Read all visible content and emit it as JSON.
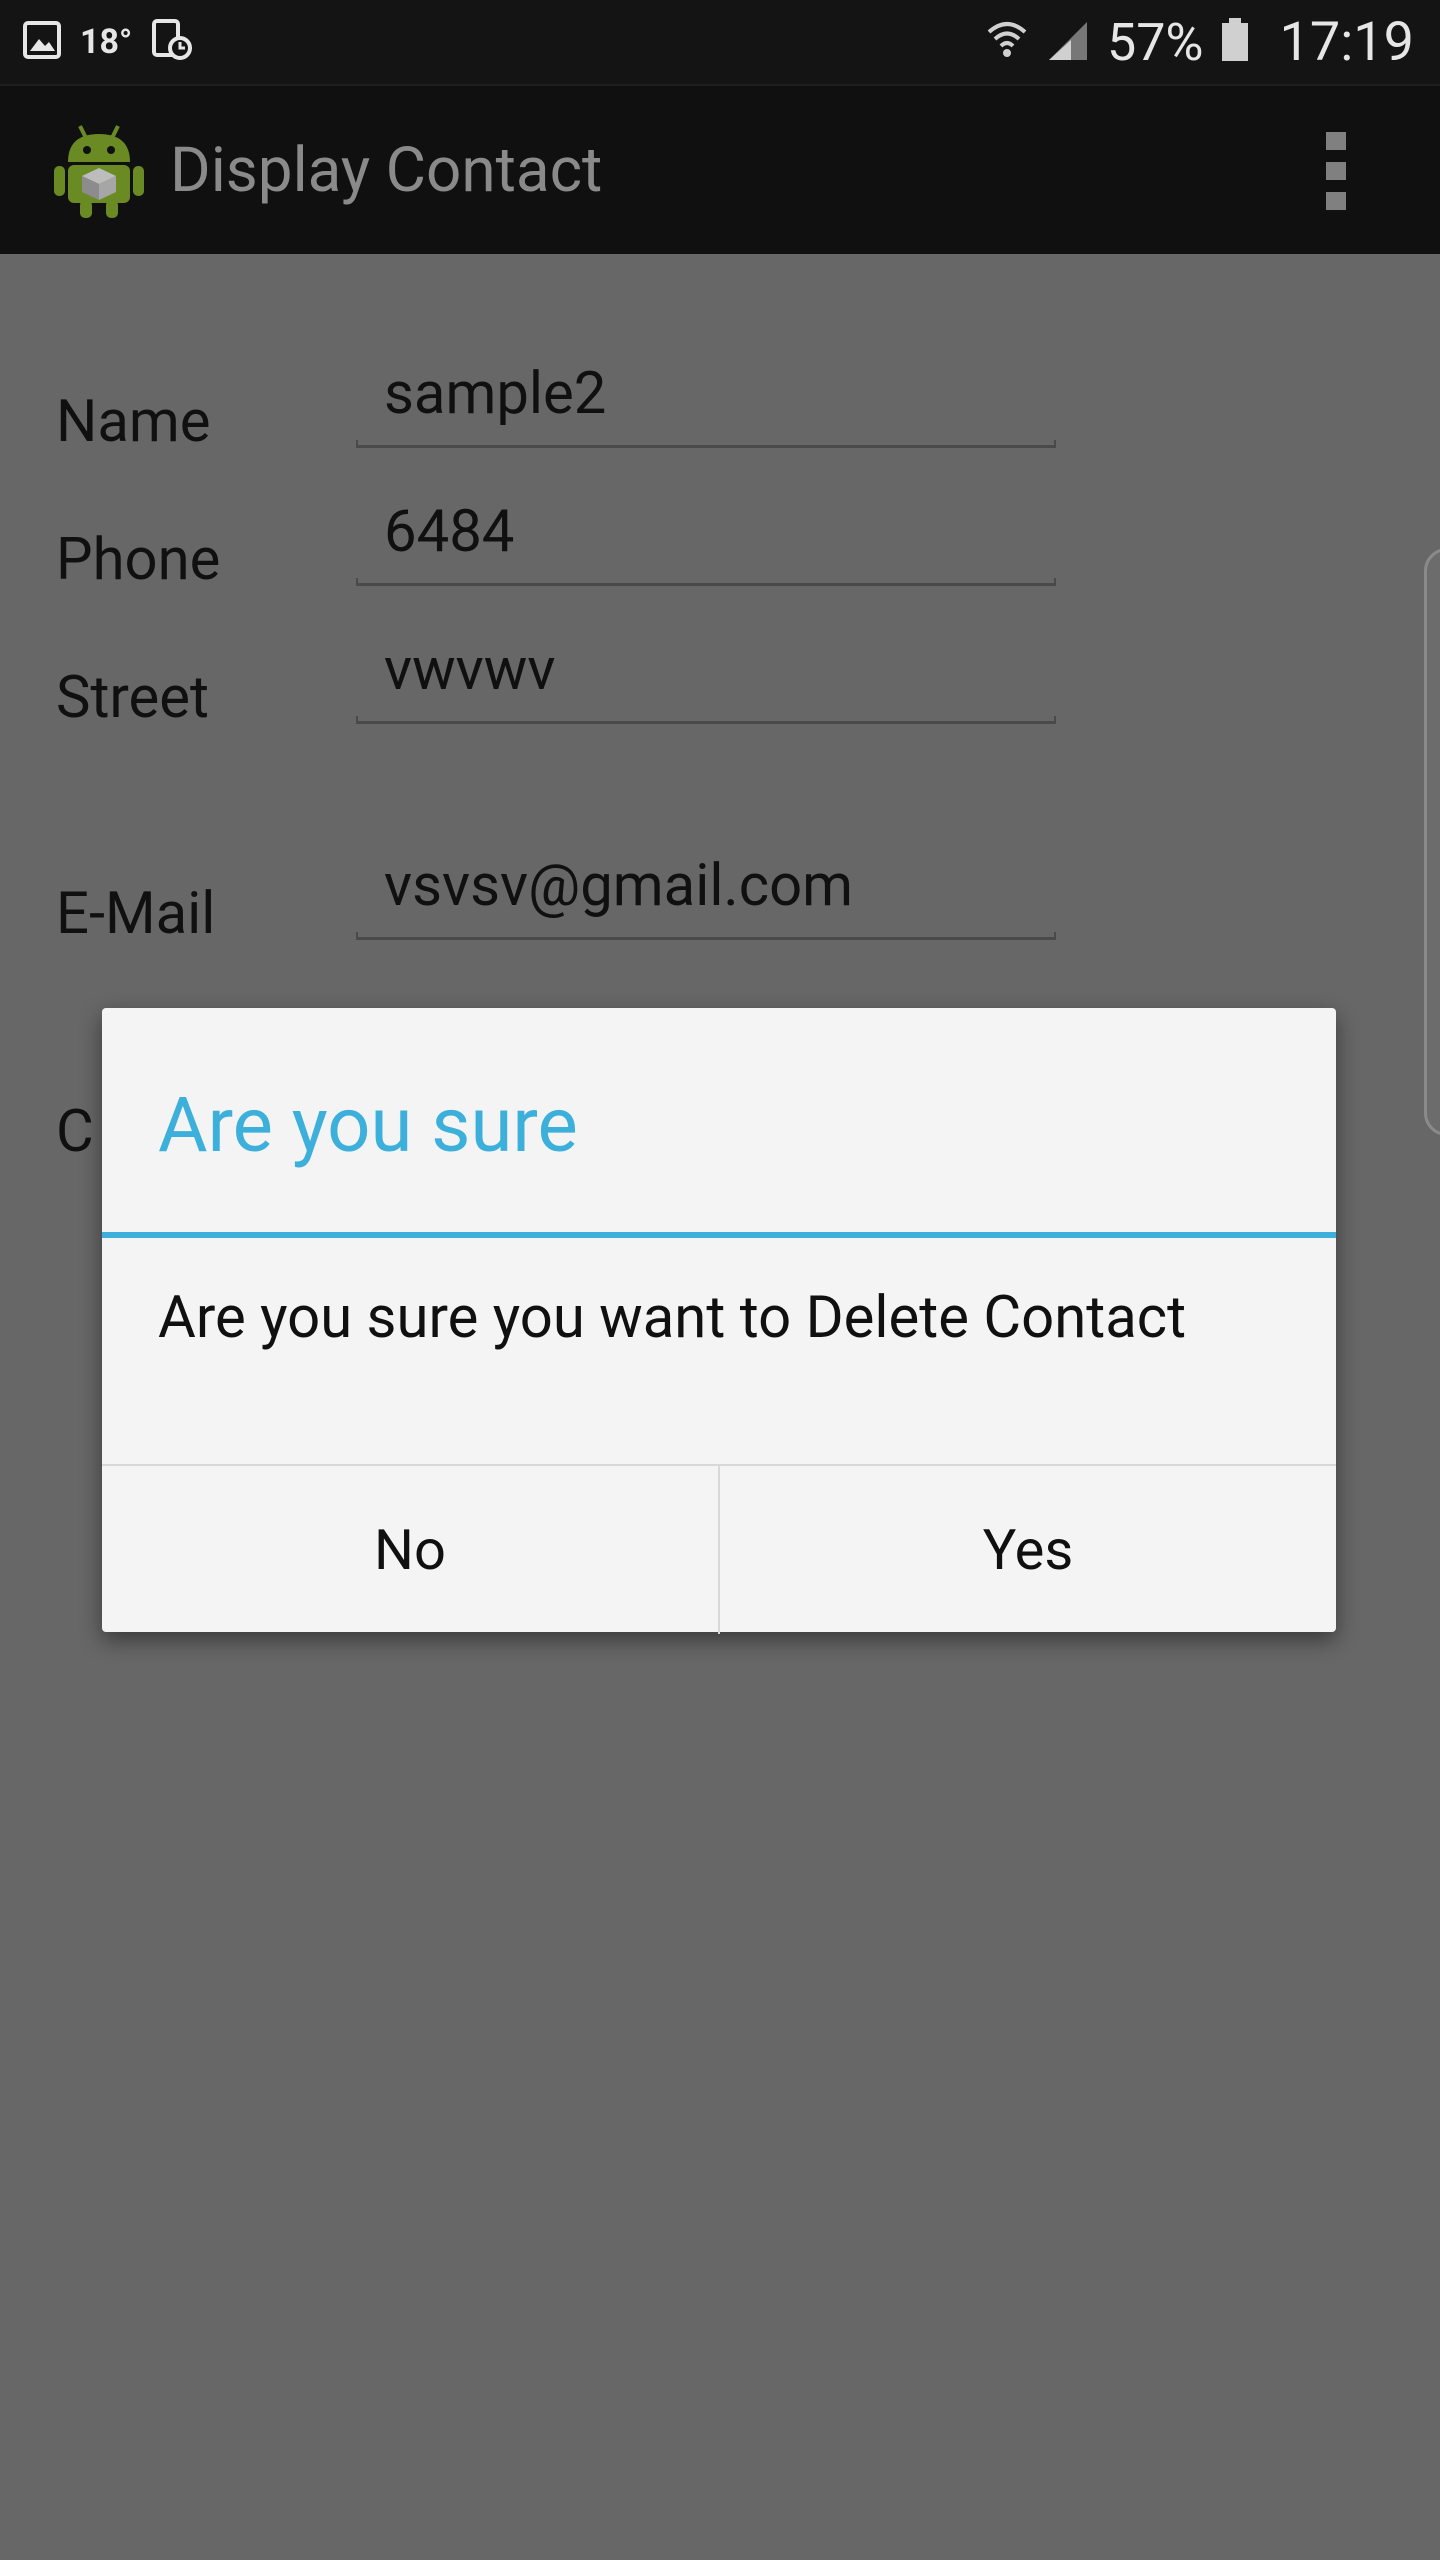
{
  "status_bar": {
    "temperature": "18°",
    "battery_percent": "57%",
    "time": "17:19",
    "icons": [
      "gallery-icon",
      "data-saver-icon",
      "wifi-icon",
      "signal-icon",
      "battery-icon"
    ]
  },
  "action_bar": {
    "title": "Display Contact",
    "icons": [
      "android-app-icon",
      "overflow-menu-icon"
    ]
  },
  "form": {
    "fields": [
      {
        "label": "Name",
        "value": "sample2"
      },
      {
        "label": "Phone",
        "value": "6484"
      },
      {
        "label": "Street",
        "value": "vwvwv"
      },
      {
        "label": "E-Mail",
        "value": "vsvsv@gmail.com"
      }
    ],
    "partial_label": "C"
  },
  "dialog": {
    "title": "Are you sure",
    "message": "Are you sure you want to Delete Contact",
    "no_label": "No",
    "yes_label": "Yes"
  },
  "colors": {
    "accent": "#3cb0da",
    "scrim_background": "#676767",
    "status_bar": "#141414",
    "action_bar": "#101010",
    "dialog_background": "#f4f4f4"
  }
}
